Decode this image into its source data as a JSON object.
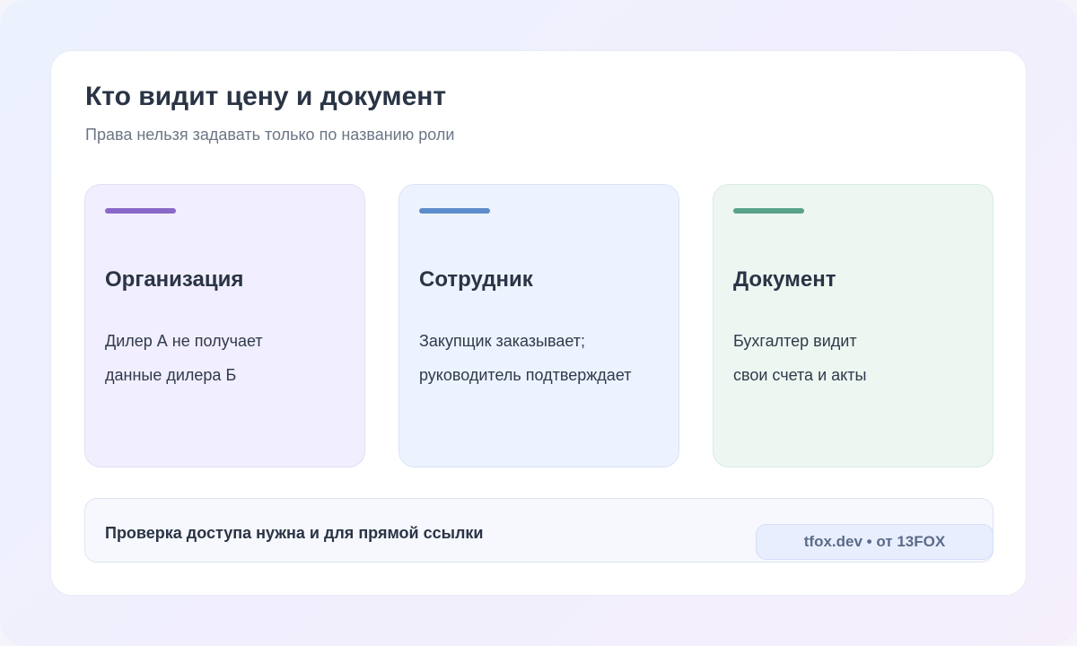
{
  "header": {
    "title": "Кто видит цену и документ",
    "subtitle": "Права нельзя задавать только по названию роли"
  },
  "tiles": [
    {
      "title": "Организация",
      "line1": "Дилер А не получает",
      "line2": "данные дилера Б",
      "accent": "#8a68c8"
    },
    {
      "title": "Сотрудник",
      "line1": "Закупщик заказывает;",
      "line2": "руководитель подтверждает",
      "accent": "#5c8ccb"
    },
    {
      "title": "Документ",
      "line1": "Бухгалтер видит",
      "line2": "свои счета и акты",
      "accent": "#58a38a"
    }
  ],
  "footer": {
    "text": "Проверка доступа нужна и для прямой ссылки",
    "badge": "tfox.dev • от 13FOX"
  }
}
